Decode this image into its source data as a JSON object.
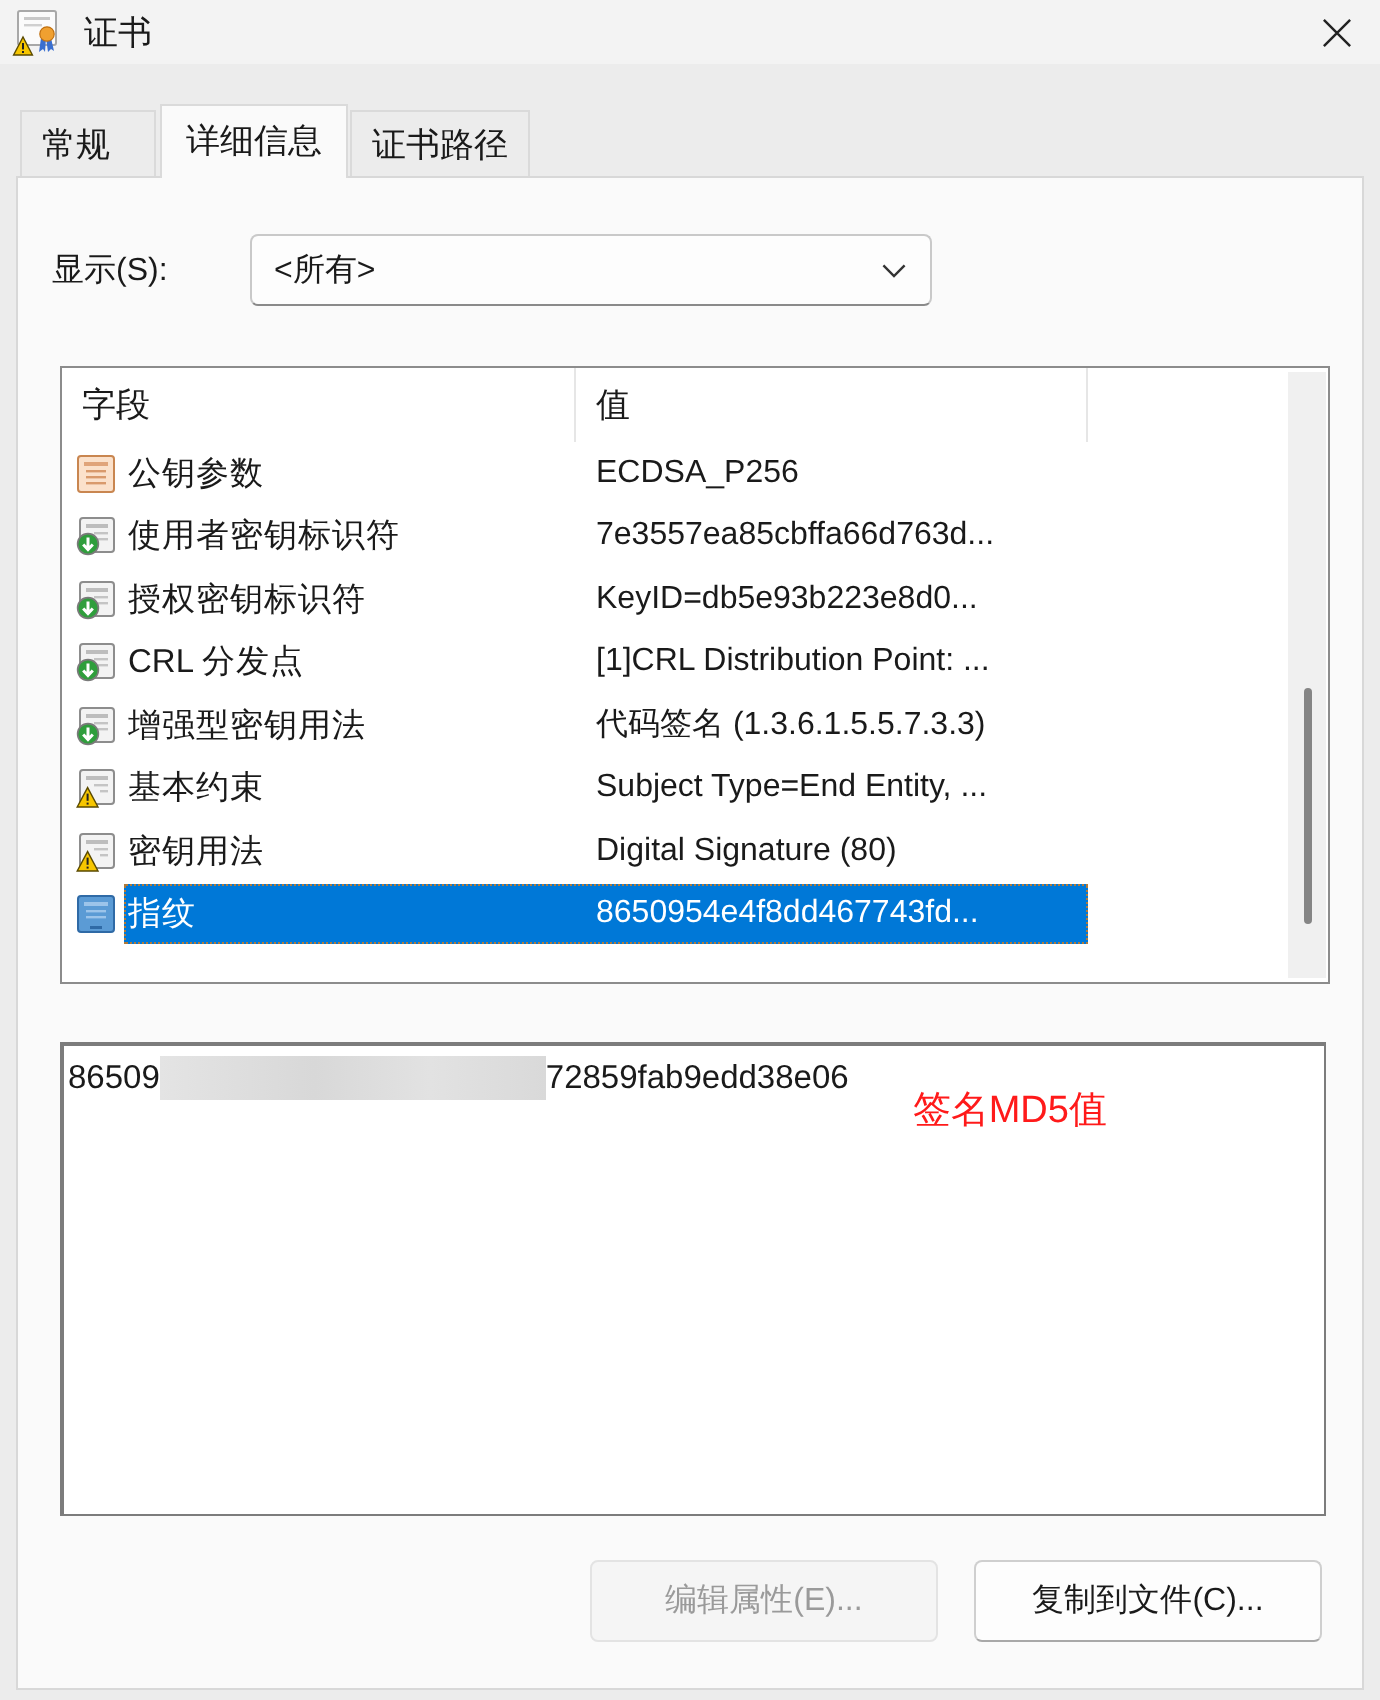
{
  "window": {
    "title": "证书"
  },
  "tabs": [
    {
      "label": "常规",
      "selected": false
    },
    {
      "label": "详细信息",
      "selected": true
    },
    {
      "label": "证书路径",
      "selected": false
    }
  ],
  "filter": {
    "label": "显示(S):",
    "value": "<所有>"
  },
  "fields_table": {
    "columns": [
      "字段",
      "值"
    ],
    "rows": [
      {
        "kind": "field",
        "field": "公钥参数",
        "value": "ECDSA_P256",
        "selected": false
      },
      {
        "kind": "extension",
        "field": "使用者密钥标识符",
        "value": "7e3557ea85cbffa66d763d...",
        "selected": false
      },
      {
        "kind": "extension",
        "field": "授权密钥标识符",
        "value": "KeyID=db5e93b223e8d0...",
        "selected": false
      },
      {
        "kind": "extension",
        "field": "CRL 分发点",
        "value": "[1]CRL Distribution Point: ...",
        "selected": false
      },
      {
        "kind": "extension",
        "field": "增强型密钥用法",
        "value": "代码签名 (1.3.6.1.5.5.7.3.3)",
        "selected": false
      },
      {
        "kind": "critical",
        "field": "基本约束",
        "value": "Subject Type=End Entity, ...",
        "selected": false
      },
      {
        "kind": "critical",
        "field": "密钥用法",
        "value": "Digital Signature (80)",
        "selected": false
      },
      {
        "kind": "property",
        "field": "指纹",
        "value": "8650954e4f8dd467743fd...",
        "selected": true
      }
    ]
  },
  "details": {
    "segments": [
      {
        "kind": "text",
        "text": "86509"
      },
      {
        "kind": "redacted"
      },
      {
        "kind": "text",
        "text": "72859fab9edd38e06"
      }
    ],
    "annotation": "签名MD5值"
  },
  "buttons": [
    {
      "label": "编辑属性(E)...",
      "disabled": true
    },
    {
      "label": "复制到文件(C)...",
      "disabled": false
    }
  ]
}
